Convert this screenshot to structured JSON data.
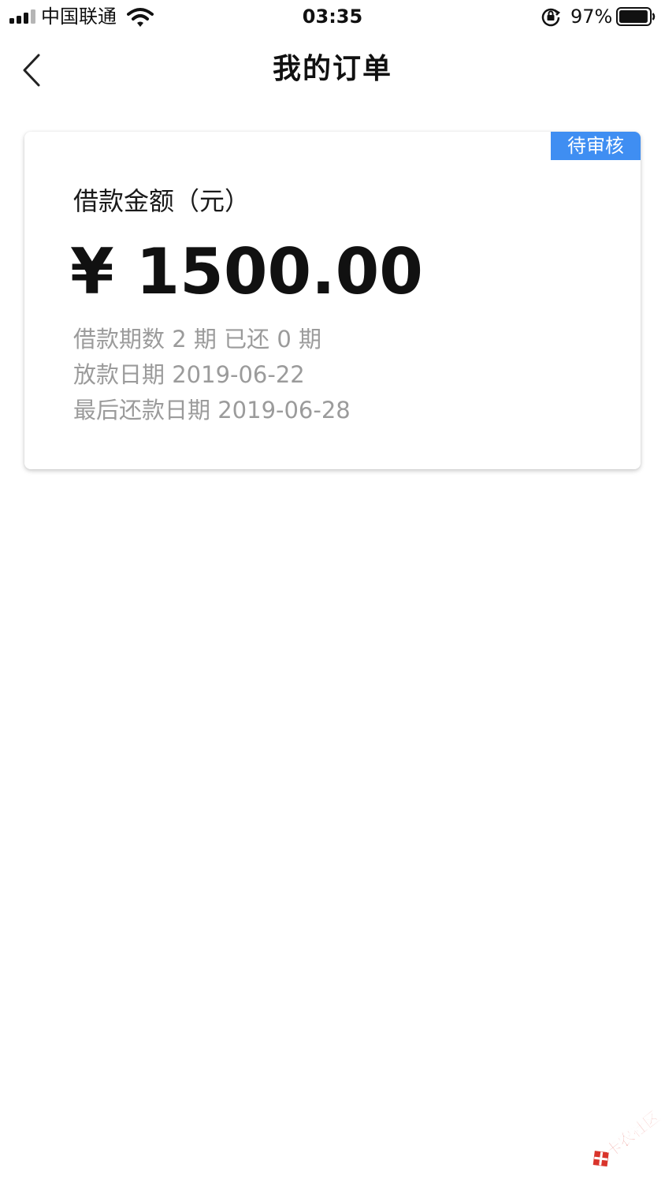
{
  "status_bar": {
    "carrier": "中国联通",
    "time": "03:35",
    "battery_percent": "97%",
    "battery_level": 0.97,
    "signal_bars_filled": 3,
    "signal_bars_total": 4
  },
  "nav": {
    "title": "我的订单",
    "back_icon": "chevron-left-icon"
  },
  "order": {
    "status": "待审核",
    "status_color": "#3f8ef2",
    "amount_label": "借款金额（元）",
    "amount": "¥ 1500.00",
    "installments": "借款期数 2 期 已还 0 期",
    "disburse_date": "放款日期 2019-06-22",
    "last_repay_date": "最后还款日期 2019-06-28"
  },
  "watermark": {
    "text": "卡农社区",
    "color": "#d9342b"
  }
}
